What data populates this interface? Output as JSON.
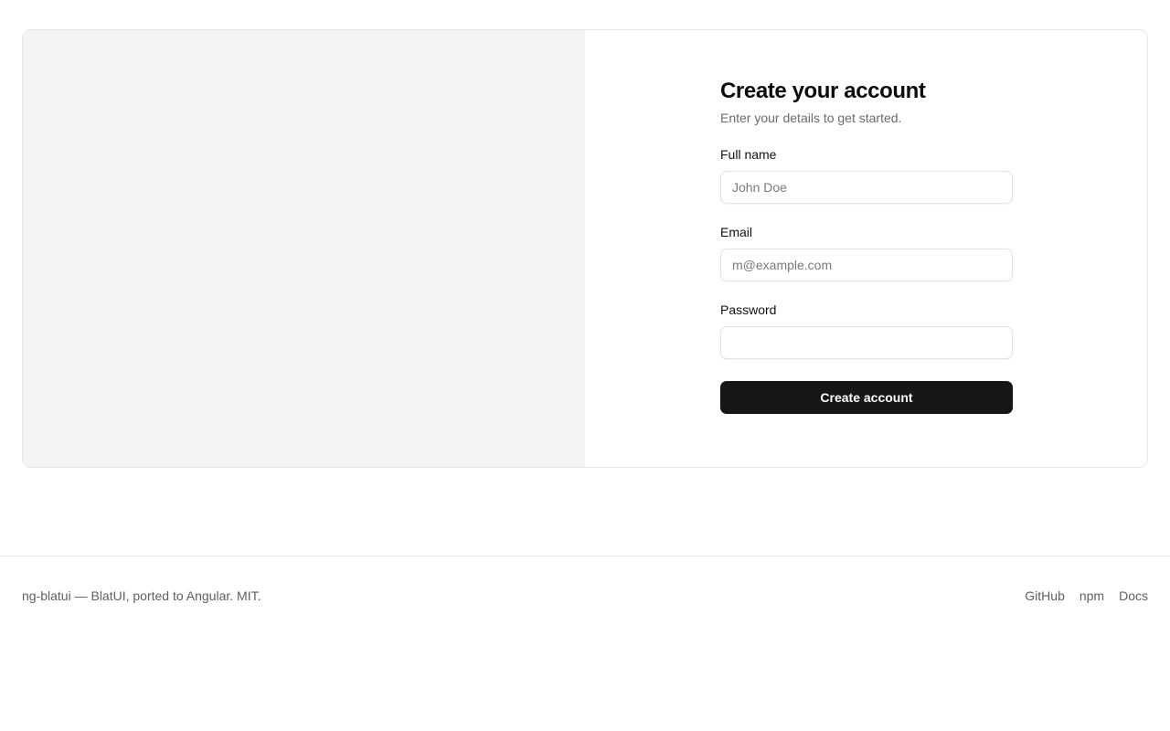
{
  "signup": {
    "title": "Create your account",
    "subtitle": "Enter your details to get started.",
    "fields": [
      {
        "label": "Full name",
        "placeholder": "John Doe",
        "value": ""
      },
      {
        "label": "Email",
        "placeholder": "m@example.com",
        "value": ""
      },
      {
        "label": "Password",
        "placeholder": "",
        "value": ""
      }
    ],
    "submit_label": "Create account"
  },
  "footer": {
    "text": "ng-blatui — BlatUI, ported to Angular. MIT.",
    "links": [
      "GitHub",
      "npm",
      "Docs"
    ]
  },
  "colors": {
    "primary_button": "#161616",
    "media_panel": "#f4f4f4",
    "border": "#e6e6e6"
  }
}
